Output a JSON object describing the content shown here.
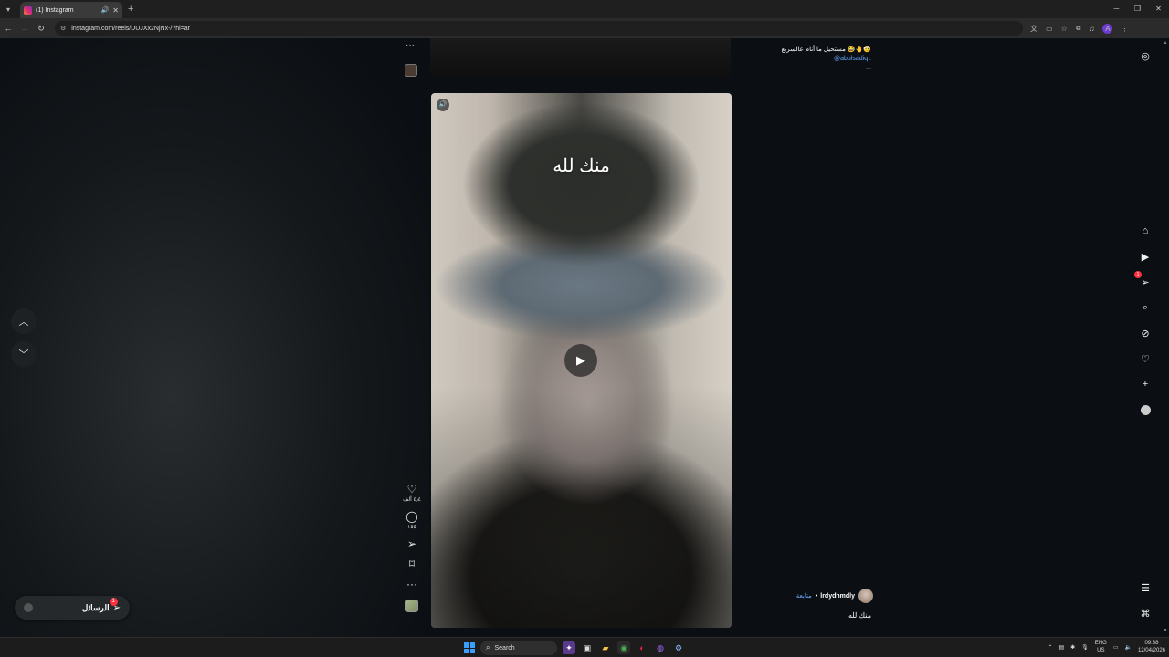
{
  "browser": {
    "tab_title": "(1) Instagram",
    "url": "instagram.com/reels/DUJXx2NjNx-/?hl=ar"
  },
  "reel": {
    "overlay_text": "منك لله",
    "author_username": "lrdydhmdly",
    "follow_label": "متابعة",
    "caption": "منك لله",
    "likes": "٤٫٤ ألف",
    "comments": "١٥٥"
  },
  "previous_reel": {
    "caption_text": "مستحيل ما أنام عالسريع 😂🤚🤕",
    "caption_handle": "@abulsadiq .",
    "caption_more": "..."
  },
  "messages_pill": {
    "label": "الرسائل",
    "badge": "1"
  },
  "ig_nav": {
    "notifications_badge": "1"
  },
  "taskbar": {
    "search_label": "Search",
    "lang_top": "ENG",
    "lang_bottom": "US",
    "time": "09:38",
    "date": "12/04/2026"
  },
  "colors": {
    "accent_link": "#6aa7ff",
    "badge": "#ff3040",
    "background": "#0b0f13"
  }
}
